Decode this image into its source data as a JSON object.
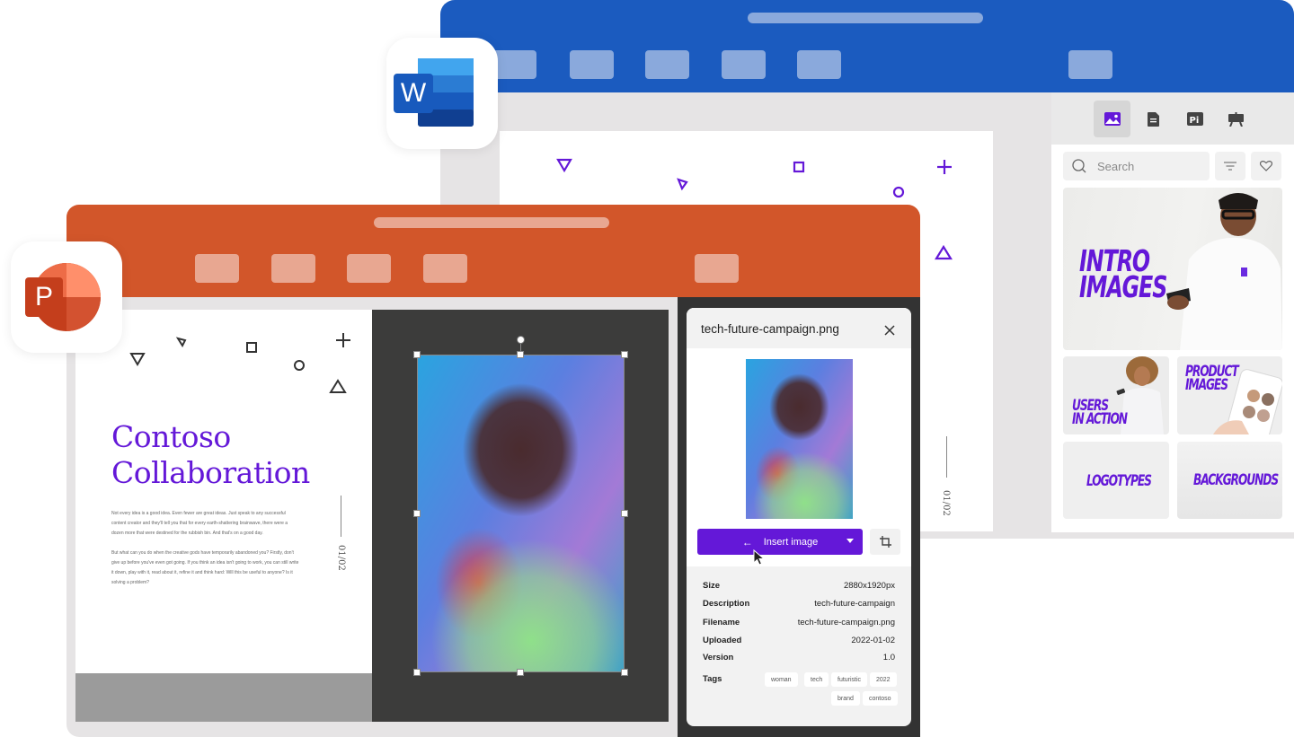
{
  "word_window": {
    "app": "Microsoft Word",
    "brand_color": "#1b5bbf",
    "sidebar": {
      "tabs": [
        {
          "name": "images",
          "icon": "image-icon",
          "active": true
        },
        {
          "name": "documents",
          "icon": "document-icon",
          "active": false
        },
        {
          "name": "pi",
          "icon": "pi-icon",
          "active": false
        },
        {
          "name": "presentations",
          "icon": "easel-icon",
          "active": false
        }
      ],
      "search_placeholder": "Search",
      "filter_icon": "filter-icon",
      "favorites_icon": "heart-icon",
      "tiles": [
        {
          "label_line1": "INTRO",
          "label_line2": "IMAGES"
        },
        {
          "label_line1": "USERS",
          "label_line2": "IN ACTION"
        },
        {
          "label_line1": "PRODUCT",
          "label_line2": "IMAGES"
        },
        {
          "label_line1": "LOGOTYPES",
          "label_line2": ""
        },
        {
          "label_line1": "BACKGROUNDS",
          "label_line2": ""
        }
      ]
    },
    "page_number": "01/02"
  },
  "ppt_window": {
    "app": "Microsoft PowerPoint",
    "brand_color": "#d2562a",
    "slide": {
      "title_line1": "Contoso",
      "title_line2": "Collaboration",
      "paragraph1": "Not every idea is a good idea. Even fewer are great ideas. Just speak to any successful content creator and they'll tell you that for every earth-shattering brainwave, there were a dozen more that were destined for the rubbish bin. And that's on a good day.",
      "paragraph2": "But what can you do when the creative gods have temporarily abandoned you? Firstly, don't give up before you've even got going. If you think an idea isn't going to work, you can still write it down, play with it, read about it, refine it and think hard: Will this be useful to anyone? Is it solving a problem?",
      "page_number": "01/02",
      "accent_color": "#6418d8"
    }
  },
  "detail_panel": {
    "title": "tech-future-campaign.png",
    "insert_label": "Insert image",
    "meta": [
      {
        "key": "Size",
        "value": "2880x1920px"
      },
      {
        "key": "Description",
        "value": "tech-future-campaign"
      },
      {
        "key": "Filename",
        "value": "tech-future-campaign.png"
      },
      {
        "key": "Uploaded",
        "value": "2022-01-02"
      },
      {
        "key": "Version",
        "value": "1.0"
      }
    ],
    "tags_label": "Tags",
    "tags": [
      "woman",
      "tech",
      "futuristic",
      "2022",
      "brand",
      "contoso"
    ],
    "button_color": "#6418d8"
  },
  "app_icons": {
    "word_letter": "W",
    "ppt_letter": "P"
  }
}
